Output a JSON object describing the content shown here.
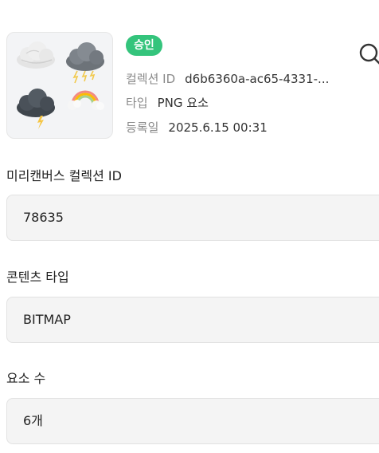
{
  "collection": {
    "status_badge": "승인",
    "id_label": "컬렉션 ID",
    "id_value": "d6b6360a-ac65-4331-...",
    "type_label": "타입",
    "type_value": "PNG 요소",
    "registered_label": "등록일",
    "registered_value": "2025.6.15 00:31",
    "thumbnail_icons": [
      "cloud-icon",
      "storm-cloud-icon",
      "lightning-cloud-icon",
      "rainbow-cloud-icon"
    ]
  },
  "fields": [
    {
      "label": "미리캔버스 컬렉션 ID",
      "value": "78635"
    },
    {
      "label": "콘텐츠 타입",
      "value": "BITMAP"
    },
    {
      "label": "요소 수",
      "value": "6개"
    }
  ],
  "colors": {
    "badge_green": "#34c47c",
    "field_bg": "#f4f4f4"
  }
}
